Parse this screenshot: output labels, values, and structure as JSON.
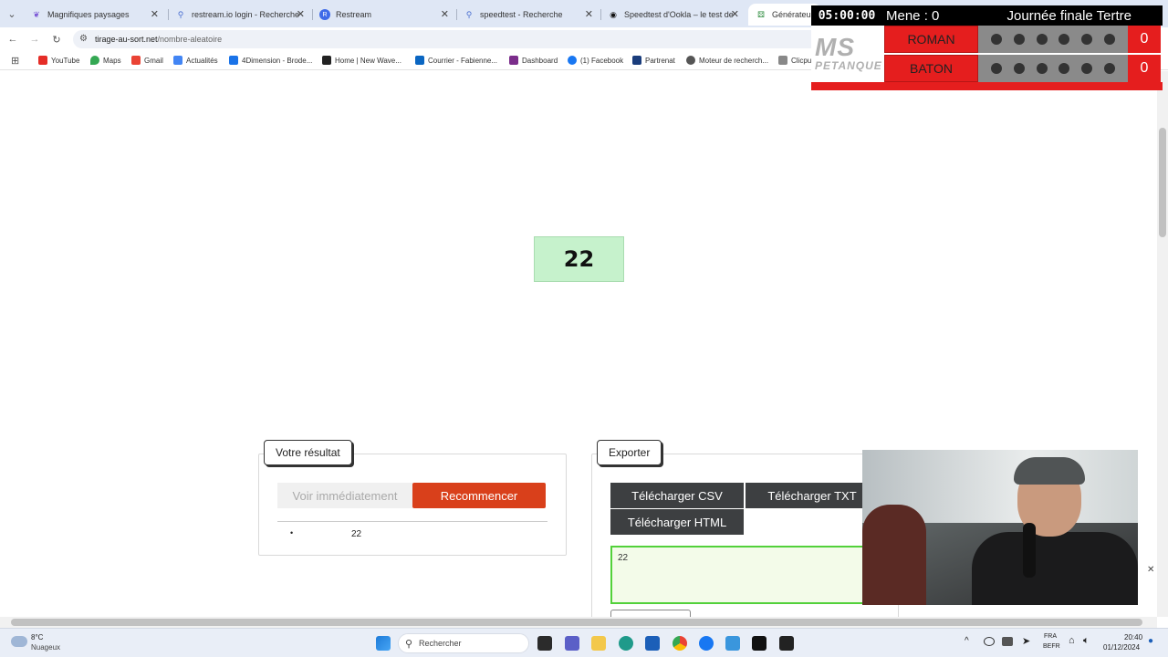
{
  "tabs": [
    {
      "title": "Magnifiques paysages",
      "icon": "butterfly-icon"
    },
    {
      "title": "restream.io login - Recherche",
      "icon": "search-icon"
    },
    {
      "title": "Restream",
      "icon": "restream-icon"
    },
    {
      "title": "speedtest - Recherche",
      "icon": "search-icon"
    },
    {
      "title": "Speedtest d'Ookla – le test de",
      "icon": "speedtest-icon"
    },
    {
      "title": "Générateur de",
      "icon": "dice-icon"
    }
  ],
  "nav": {
    "url_host": "tirage-au-sort.net",
    "url_path": "/nombre-aleatoire"
  },
  "bookmarks": [
    {
      "label": "YouTube",
      "color": "#e52d27"
    },
    {
      "label": "Maps",
      "color": "#34a853"
    },
    {
      "label": "Gmail",
      "color": "#ea4335"
    },
    {
      "label": "Actualités",
      "color": "#4285f4"
    },
    {
      "label": "4Dimension - Brode...",
      "color": "#1a73e8"
    },
    {
      "label": "Home | New Wave...",
      "color": "#222222"
    },
    {
      "label": "Courrier - Fabienne...",
      "color": "#0a66c2"
    },
    {
      "label": "Dashboard",
      "color": "#7b2d8b"
    },
    {
      "label": "(1) Facebook",
      "color": "#1877f2"
    },
    {
      "label": "Partrenat",
      "color": "#1a3d7c"
    },
    {
      "label": "Moteur de recherch...",
      "color": "#555555"
    },
    {
      "label": "Clicpubli",
      "color": "#888888"
    }
  ],
  "scoreboard": {
    "timer": "05:00:00",
    "mene": "Mene : 0",
    "title": "Journée finale Tertre",
    "logo_top": "MS",
    "logo_bottom": "PETANQUE",
    "teams": [
      {
        "name": "ROMAN",
        "points": "0"
      },
      {
        "name": "BATON",
        "points": "0"
      }
    ]
  },
  "result": {
    "number": "22"
  },
  "votre_resultat": {
    "legend": "Votre résultat",
    "btn_voir": "Voir immédiatement",
    "btn_recommencer": "Recommencer",
    "list_item": "22"
  },
  "exporter": {
    "legend": "Exporter",
    "btn_csv": "Télécharger CSV",
    "btn_txt": "Télécharger TXT",
    "btn_html": "Télécharger HTML",
    "textarea_value": "22"
  },
  "taskbar": {
    "weather_temp": "8°C",
    "weather_desc": "Nuageux",
    "search_placeholder": "Rechercher",
    "lang_top": "FRA",
    "lang_bottom": "BEFR",
    "time": "20:40",
    "date": "01/12/2024"
  },
  "colors": {
    "accent_red": "#d9401b",
    "result_green": "#c6f2cc",
    "scoreboard_red": "#e51e1e"
  }
}
